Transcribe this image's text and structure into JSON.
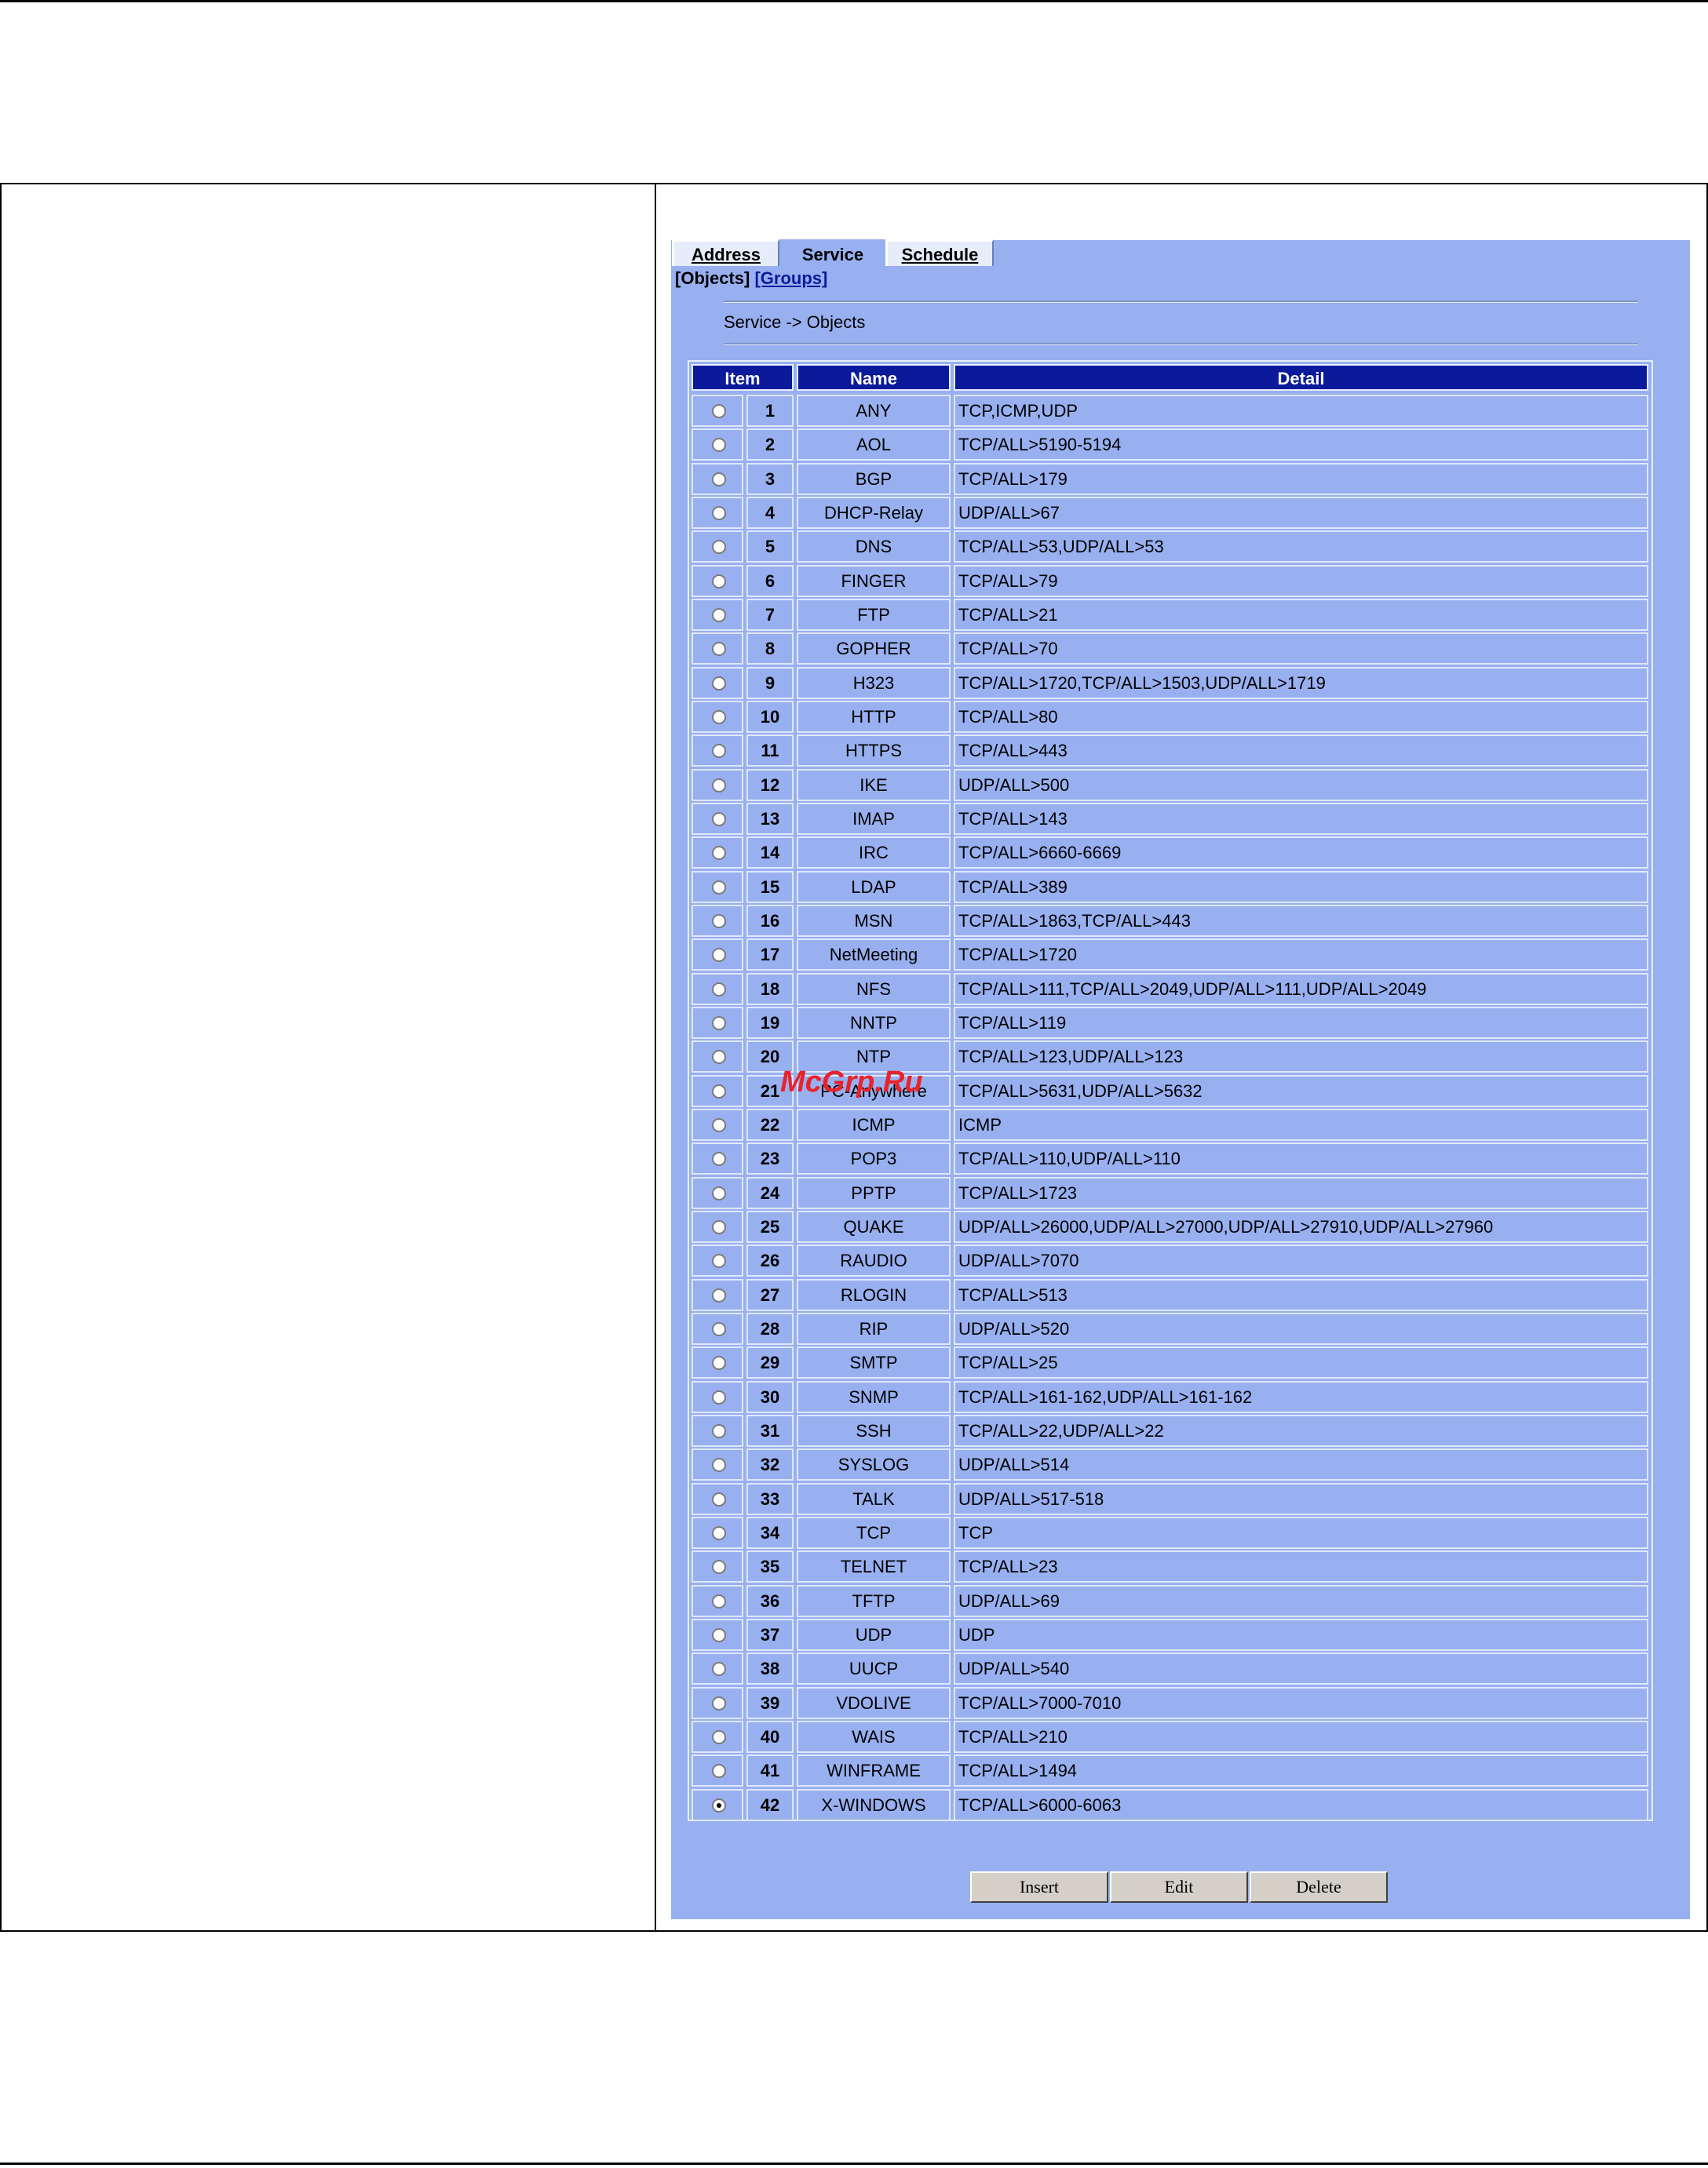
{
  "tabs": [
    {
      "label": "Address",
      "active": false
    },
    {
      "label": "Service",
      "active": true
    },
    {
      "label": "Schedule",
      "active": false
    }
  ],
  "sublinks": {
    "objects": "[Objects]",
    "groups": "[Groups]"
  },
  "breadcrumb": "Service -> Objects",
  "table": {
    "headers": {
      "item": "Item",
      "name": "Name",
      "detail": "Detail"
    },
    "rows": [
      {
        "num": "1",
        "name": "ANY",
        "detail": "TCP,ICMP,UDP",
        "selected": false
      },
      {
        "num": "2",
        "name": "AOL",
        "detail": "TCP/ALL>5190-5194",
        "selected": false
      },
      {
        "num": "3",
        "name": "BGP",
        "detail": "TCP/ALL>179",
        "selected": false
      },
      {
        "num": "4",
        "name": "DHCP-Relay",
        "detail": "UDP/ALL>67",
        "selected": false
      },
      {
        "num": "5",
        "name": "DNS",
        "detail": "TCP/ALL>53,UDP/ALL>53",
        "selected": false
      },
      {
        "num": "6",
        "name": "FINGER",
        "detail": "TCP/ALL>79",
        "selected": false
      },
      {
        "num": "7",
        "name": "FTP",
        "detail": "TCP/ALL>21",
        "selected": false
      },
      {
        "num": "8",
        "name": "GOPHER",
        "detail": "TCP/ALL>70",
        "selected": false
      },
      {
        "num": "9",
        "name": "H323",
        "detail": "TCP/ALL>1720,TCP/ALL>1503,UDP/ALL>1719",
        "selected": false
      },
      {
        "num": "10",
        "name": "HTTP",
        "detail": "TCP/ALL>80",
        "selected": false
      },
      {
        "num": "11",
        "name": "HTTPS",
        "detail": "TCP/ALL>443",
        "selected": false
      },
      {
        "num": "12",
        "name": "IKE",
        "detail": "UDP/ALL>500",
        "selected": false
      },
      {
        "num": "13",
        "name": "IMAP",
        "detail": "TCP/ALL>143",
        "selected": false
      },
      {
        "num": "14",
        "name": "IRC",
        "detail": "TCP/ALL>6660-6669",
        "selected": false
      },
      {
        "num": "15",
        "name": "LDAP",
        "detail": "TCP/ALL>389",
        "selected": false
      },
      {
        "num": "16",
        "name": "MSN",
        "detail": "TCP/ALL>1863,TCP/ALL>443",
        "selected": false
      },
      {
        "num": "17",
        "name": "NetMeeting",
        "detail": "TCP/ALL>1720",
        "selected": false
      },
      {
        "num": "18",
        "name": "NFS",
        "detail": "TCP/ALL>111,TCP/ALL>2049,UDP/ALL>111,UDP/ALL>2049",
        "selected": false
      },
      {
        "num": "19",
        "name": "NNTP",
        "detail": "TCP/ALL>119",
        "selected": false
      },
      {
        "num": "20",
        "name": "NTP",
        "detail": "TCP/ALL>123,UDP/ALL>123",
        "selected": false
      },
      {
        "num": "21",
        "name": "PC-Anywhere",
        "detail": "TCP/ALL>5631,UDP/ALL>5632",
        "selected": false
      },
      {
        "num": "22",
        "name": "ICMP",
        "detail": "ICMP",
        "selected": false
      },
      {
        "num": "23",
        "name": "POP3",
        "detail": "TCP/ALL>110,UDP/ALL>110",
        "selected": false
      },
      {
        "num": "24",
        "name": "PPTP",
        "detail": "TCP/ALL>1723",
        "selected": false
      },
      {
        "num": "25",
        "name": "QUAKE",
        "detail": "UDP/ALL>26000,UDP/ALL>27000,UDP/ALL>27910,UDP/ALL>27960",
        "selected": false
      },
      {
        "num": "26",
        "name": "RAUDIO",
        "detail": "UDP/ALL>7070",
        "selected": false
      },
      {
        "num": "27",
        "name": "RLOGIN",
        "detail": "TCP/ALL>513",
        "selected": false
      },
      {
        "num": "28",
        "name": "RIP",
        "detail": "UDP/ALL>520",
        "selected": false
      },
      {
        "num": "29",
        "name": "SMTP",
        "detail": "TCP/ALL>25",
        "selected": false
      },
      {
        "num": "30",
        "name": "SNMP",
        "detail": "TCP/ALL>161-162,UDP/ALL>161-162",
        "selected": false
      },
      {
        "num": "31",
        "name": "SSH",
        "detail": "TCP/ALL>22,UDP/ALL>22",
        "selected": false
      },
      {
        "num": "32",
        "name": "SYSLOG",
        "detail": "UDP/ALL>514",
        "selected": false
      },
      {
        "num": "33",
        "name": "TALK",
        "detail": "UDP/ALL>517-518",
        "selected": false
      },
      {
        "num": "34",
        "name": "TCP",
        "detail": "TCP",
        "selected": false
      },
      {
        "num": "35",
        "name": "TELNET",
        "detail": "TCP/ALL>23",
        "selected": false
      },
      {
        "num": "36",
        "name": "TFTP",
        "detail": "UDP/ALL>69",
        "selected": false
      },
      {
        "num": "37",
        "name": "UDP",
        "detail": "UDP",
        "selected": false
      },
      {
        "num": "38",
        "name": "UUCP",
        "detail": "UDP/ALL>540",
        "selected": false
      },
      {
        "num": "39",
        "name": "VDOLIVE",
        "detail": "TCP/ALL>7000-7010",
        "selected": false
      },
      {
        "num": "40",
        "name": "WAIS",
        "detail": "TCP/ALL>210",
        "selected": false
      },
      {
        "num": "41",
        "name": "WINFRAME",
        "detail": "TCP/ALL>1494",
        "selected": false
      },
      {
        "num": "42",
        "name": "X-WINDOWS",
        "detail": "TCP/ALL>6000-6063",
        "selected": true
      }
    ]
  },
  "buttons": {
    "insert": "Insert",
    "edit": "Edit",
    "delete": "Delete"
  },
  "watermark": "McGrp.Ru",
  "colors": {
    "panel": "#98b0f0",
    "header": "#0a1a9a",
    "link": "#0a1a9a",
    "button": "#d4d0c8"
  }
}
